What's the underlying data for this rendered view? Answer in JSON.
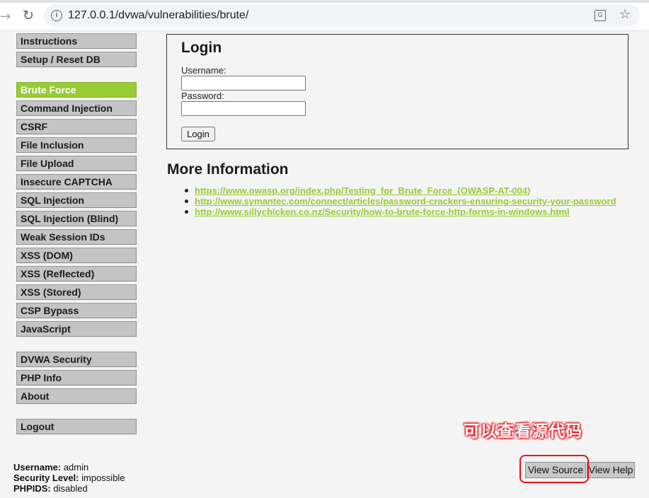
{
  "browser": {
    "url": "127.0.0.1/dvwa/vulnerabilities/brute/",
    "back_icon": "arrow-right-icon",
    "reload_icon": "reload-icon",
    "site_info_icon": "info-icon",
    "translate_icon": "translate-icon",
    "bookmark_icon": "star-icon"
  },
  "menu": {
    "group1": [
      "Instructions",
      "Setup / Reset DB"
    ],
    "group2": [
      "Brute Force",
      "Command Injection",
      "CSRF",
      "File Inclusion",
      "File Upload",
      "Insecure CAPTCHA",
      "SQL Injection",
      "SQL Injection (Blind)",
      "Weak Session IDs",
      "XSS (DOM)",
      "XSS (Reflected)",
      "XSS (Stored)",
      "CSP Bypass",
      "JavaScript"
    ],
    "group3": [
      "DVWA Security",
      "PHP Info",
      "About"
    ],
    "group4": [
      "Logout"
    ],
    "selected": "Brute Force",
    "accent_color": "#98cc33"
  },
  "login": {
    "title": "Login",
    "username_label": "Username:",
    "username_value": "",
    "password_label": "Password:",
    "password_value": "",
    "button_label": "Login"
  },
  "more_info": {
    "heading": "More Information",
    "links": [
      "https://www.owasp.org/index.php/Testing_for_Brute_Force_(OWASP-AT-004)",
      "http://www.symantec.com/connect/articles/password-crackers-ensuring-security-your-password",
      "http://www.sillychicken.co.nz/Security/how-to-brute-force-http-forms-in-windows.html"
    ]
  },
  "user_info": {
    "username_label": "Username:",
    "username_value": "admin",
    "security_label": "Security Level:",
    "security_value": "impossible",
    "phpids_label": "PHPIDS:",
    "phpids_value": "disabled"
  },
  "footer_buttons": {
    "view_source": "View Source",
    "view_help": "View Help"
  },
  "annotation": {
    "text": "可以查看源代码",
    "color": "#e8101a"
  }
}
